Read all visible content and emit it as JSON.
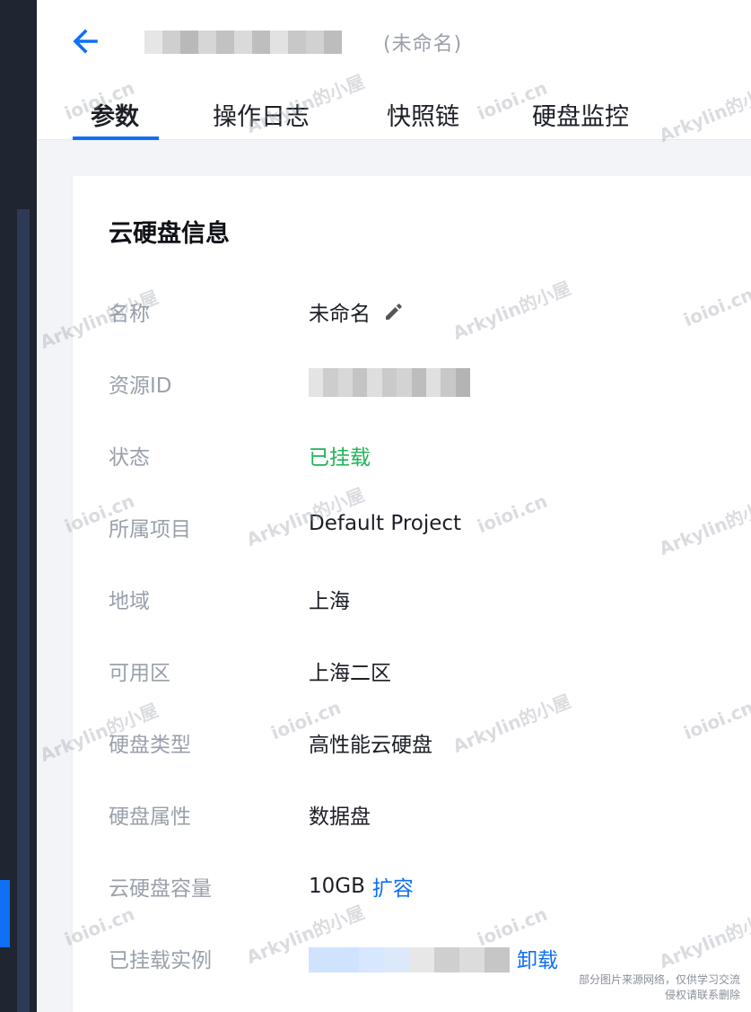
{
  "header": {
    "back_label": "back",
    "title_sub": "(未命名)",
    "tabs": [
      {
        "label": "参数",
        "active": true
      },
      {
        "label": "操作日志",
        "active": false
      },
      {
        "label": "快照链",
        "active": false
      },
      {
        "label": "硬盘监控",
        "active": false
      }
    ]
  },
  "card": {
    "title": "云硬盘信息",
    "rows": [
      {
        "label": "名称",
        "value": "未命名"
      },
      {
        "label": "资源ID",
        "value": ""
      },
      {
        "label": "状态",
        "value": "已挂载"
      },
      {
        "label": "所属项目",
        "value": "Default Project"
      },
      {
        "label": "地域",
        "value": "上海"
      },
      {
        "label": "可用区",
        "value": "上海二区"
      },
      {
        "label": "硬盘类型",
        "value": "高性能云硬盘"
      },
      {
        "label": "硬盘属性",
        "value": "数据盘"
      },
      {
        "label": "云硬盘容量",
        "value": "10GB",
        "action": "扩容"
      },
      {
        "label": "已挂载实例",
        "value": "",
        "action": "卸载"
      }
    ]
  },
  "watermarks": {
    "text_a": "Arkylin的小屋",
    "text_b": "ioioi.cn"
  },
  "footer": {
    "line1": "部分图片来源网络，仅供学习交流",
    "line2": "侵权请联系删除"
  },
  "colors": {
    "accent": "#0f6ff5",
    "status_green": "#1fb35b",
    "label_gray": "#9aa0ab",
    "sidebar_dark": "#1f2531"
  },
  "icons": {
    "back": "arrow-left-icon",
    "edit": "pencil-icon"
  }
}
